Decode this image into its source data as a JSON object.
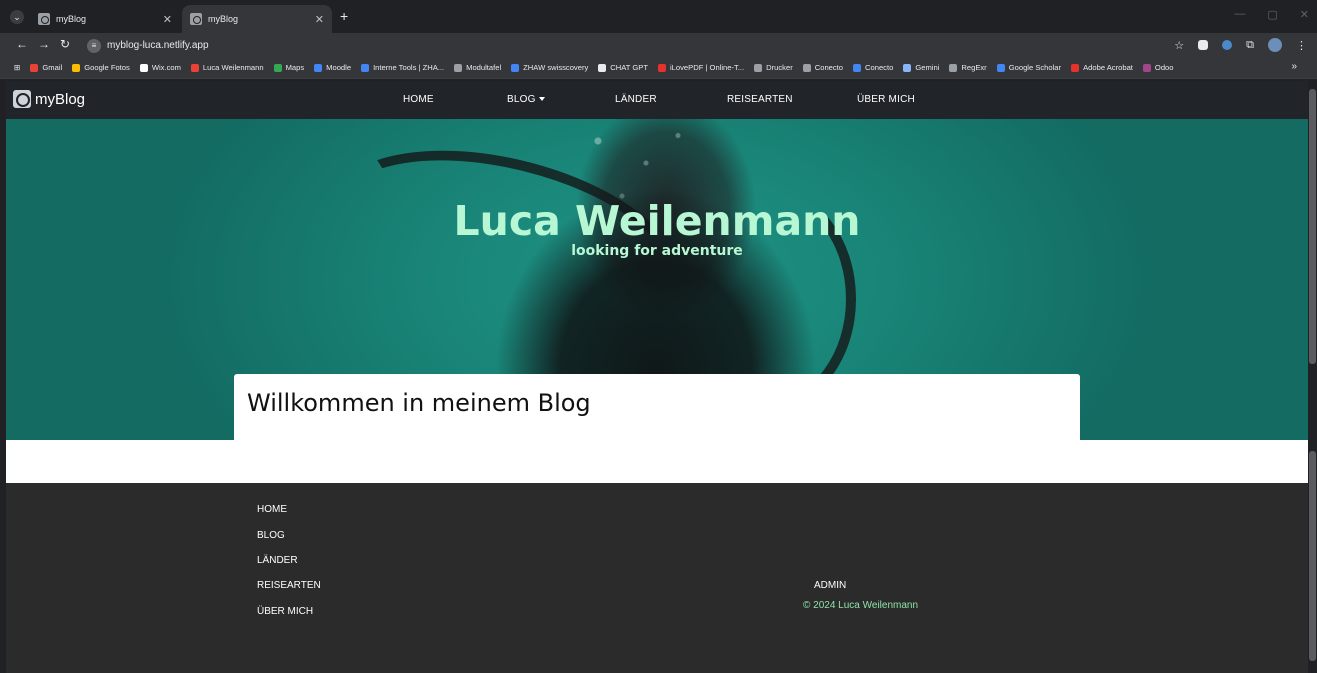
{
  "browser": {
    "tabs": [
      {
        "title": "myBlog",
        "active": false
      },
      {
        "title": "myBlog",
        "active": true
      }
    ],
    "url": "myblog-luca.netlify.app",
    "bookmarks": [
      {
        "label": "Gmail",
        "color": "#ea4335"
      },
      {
        "label": "Google Fotos",
        "color": "#fbbc04"
      },
      {
        "label": "Wix.com",
        "color": "#ffffff"
      },
      {
        "label": "Luca Weilenmann",
        "color": "#ea4335"
      },
      {
        "label": "Maps",
        "color": "#34a853"
      },
      {
        "label": "Moodle",
        "color": "#4285f4"
      },
      {
        "label": "Interne Tools | ZHA...",
        "color": "#4285f4"
      },
      {
        "label": "Modultafel",
        "color": "#9aa0a6"
      },
      {
        "label": "ZHAW swisscovery",
        "color": "#4285f4"
      },
      {
        "label": "CHAT GPT",
        "color": "#e8eaed"
      },
      {
        "label": "iLovePDF | Online-T...",
        "color": "#e5322d"
      },
      {
        "label": "Drucker",
        "color": "#9aa0a6"
      },
      {
        "label": "Conecto",
        "color": "#9aa0a6"
      },
      {
        "label": "Conecto",
        "color": "#4285f4"
      },
      {
        "label": "Gemini",
        "color": "#8ab4f8"
      },
      {
        "label": "RegExr",
        "color": "#9aa0a6"
      },
      {
        "label": "Google Scholar",
        "color": "#4285f4"
      },
      {
        "label": "Adobe Acrobat",
        "color": "#e5322d"
      },
      {
        "label": "Odoo",
        "color": "#a24689"
      }
    ]
  },
  "site": {
    "brand": "myBlog",
    "nav": {
      "home": "HOME",
      "blog": "BLOG",
      "laender": "LÄNDER",
      "reisearten": "REISEARTEN",
      "ueber_mich": "ÜBER MICH"
    },
    "hero": {
      "title": "Luca Weilenmann",
      "subtitle": "looking for adventure"
    },
    "welcome": "Willkommen in meinem Blog",
    "footer": {
      "links": [
        "HOME",
        "BLOG",
        "LÄNDER",
        "REISEARTEN",
        "ÜBER MICH"
      ],
      "admin": "ADMIN",
      "copyright": "© 2024 Luca Weilenmann"
    }
  }
}
